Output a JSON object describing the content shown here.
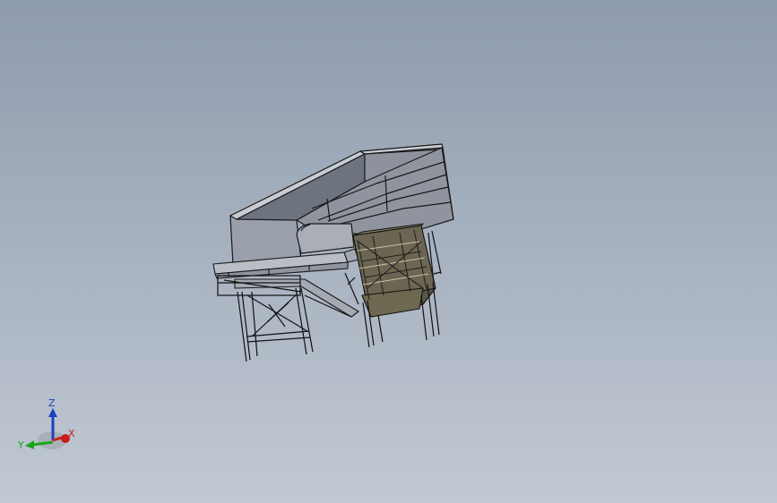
{
  "viewport": {
    "background_top": "#8e9bad",
    "background_bottom": "#c1c9d3"
  },
  "model": {
    "icon": "3d-assembly-hopper-conveyor",
    "hopper_color": "#8a8a94",
    "cabinet_color": "#5c5646",
    "frame_color": "#1a1a1a"
  },
  "triad": {
    "z_label": "Z",
    "y_label": "Y",
    "x_label": "X",
    "z_color": "#1f3fbf",
    "y_color": "#1aa51a",
    "x_color": "#c81e1e"
  }
}
